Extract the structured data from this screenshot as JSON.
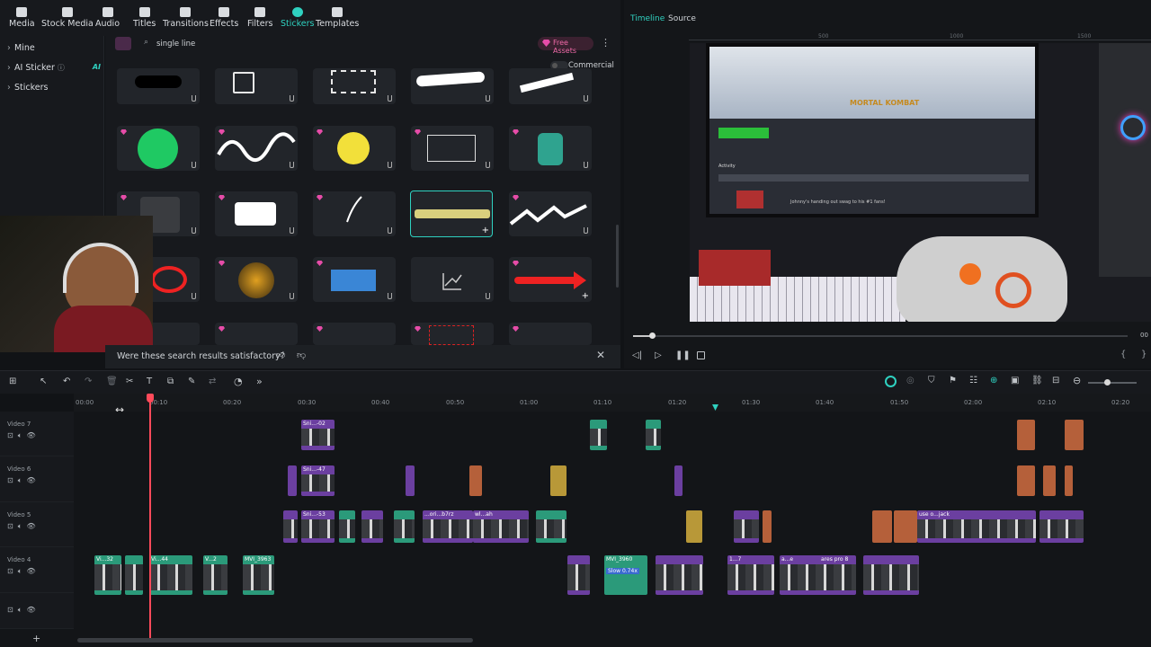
{
  "toolbar": {
    "tabs": [
      {
        "label": "Media",
        "icon": "media-icon"
      },
      {
        "label": "Stock Media",
        "icon": "stock-media-icon"
      },
      {
        "label": "Audio",
        "icon": "audio-icon"
      },
      {
        "label": "Titles",
        "icon": "titles-icon"
      },
      {
        "label": "Transitions",
        "icon": "transitions-icon"
      },
      {
        "label": "Effects",
        "icon": "effects-icon"
      },
      {
        "label": "Filters",
        "icon": "filters-icon"
      },
      {
        "label": "Stickers",
        "icon": "stickers-icon"
      },
      {
        "label": "Templates",
        "icon": "templates-icon"
      }
    ],
    "active": "Stickers",
    "accent": "#2fd1c0"
  },
  "leftnav": {
    "items": [
      {
        "label": "Mine"
      },
      {
        "label": "AI Sticker",
        "badge": "AI"
      },
      {
        "label": "Stickers"
      }
    ]
  },
  "search": {
    "value": "single line",
    "free_assets": "Free Assets",
    "commercial": "Commercial"
  },
  "feedback": {
    "question": "Were these search results satisfactory?"
  },
  "preview": {
    "tabs": [
      "Timeline",
      "Source"
    ],
    "active_tab": "Timeline",
    "ruler_marks": [
      "500",
      "1000",
      "1500"
    ],
    "game_title": "MORTAL KOMBAT",
    "screen_text": {
      "activity": "Activity",
      "news": "Johnny's handing out swag to his #1 fans!"
    },
    "playback_time_prefix": "00"
  },
  "timeline": {
    "ruler": [
      "00:00",
      "00:10",
      "00:20",
      "00:30",
      "00:40",
      "00:50",
      "01:00",
      "01:10",
      "01:20",
      "01:30",
      "01:40",
      "01:50",
      "02:00",
      "02:10",
      "02:20"
    ],
    "tracks": [
      {
        "name": "Video 7"
      },
      {
        "name": "Video 6"
      },
      {
        "name": "Video 5"
      },
      {
        "name": "Video 4"
      }
    ],
    "clip_labels": {
      "v7a": "Sni...-02",
      "v6a": "Sni...-47",
      "v5a": "Sni...-53",
      "v5b": "...ori...b7rz",
      "v5c": "wl...ah",
      "v5d": "use o...jack",
      "v4a": "Vi...32",
      "v4b": "Vi...44",
      "v4c": "V...2",
      "v4d": "MVI_3963",
      "v4e": "MVI_3960",
      "v4e_speed": "Slow 0.74x",
      "v4f": "1...7",
      "v4g": "a...e",
      "v4h": "ares pro 8"
    }
  }
}
